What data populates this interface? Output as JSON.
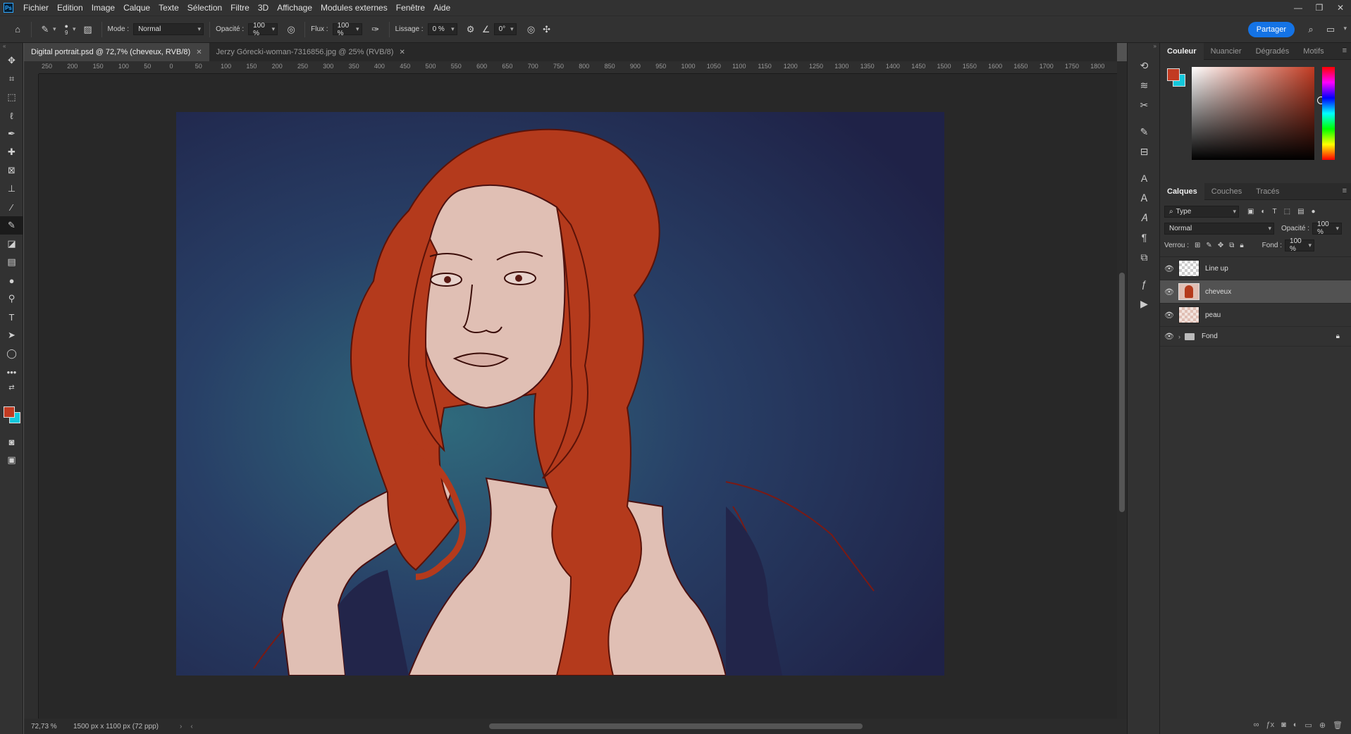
{
  "app": {
    "logo": "Ps",
    "menu": [
      "Fichier",
      "Edition",
      "Image",
      "Calque",
      "Texte",
      "Sélection",
      "Filtre",
      "3D",
      "Affichage",
      "Modules externes",
      "Fenêtre",
      "Aide"
    ]
  },
  "options": {
    "brush_size": "9",
    "mode_label": "Mode :",
    "mode_value": "Normal",
    "opacity_label": "Opacité :",
    "opacity_value": "100 %",
    "flux_label": "Flux :",
    "flux_value": "100 %",
    "lissage_label": "Lissage :",
    "lissage_value": "0 %",
    "angle_value": "0°",
    "share_label": "Partager"
  },
  "tabs": [
    {
      "label": "Digital portrait.psd @ 72,7% (cheveux, RVB/8)",
      "active": true
    },
    {
      "label": "Jerzy Górecki-woman-7316856.jpg @ 25% (RVB/8)",
      "active": false
    }
  ],
  "ruler_ticks": [
    "250",
    "200",
    "150",
    "100",
    "50",
    "0",
    "50",
    "100",
    "150",
    "200",
    "250",
    "300",
    "350",
    "400",
    "450",
    "500",
    "550",
    "600",
    "650",
    "700",
    "750",
    "800",
    "850",
    "900",
    "950",
    "1000",
    "1050",
    "1100",
    "1150",
    "1200",
    "1250",
    "1300",
    "1350",
    "1400",
    "1450",
    "1500",
    "1550",
    "1600",
    "1650",
    "1700",
    "1750",
    "1800"
  ],
  "status": {
    "zoom": "72,73 %",
    "doc_size": "1500 px x 1100 px (72 ppp)"
  },
  "color_panel": {
    "tabs": [
      "Couleur",
      "Nuancier",
      "Dégradés",
      "Motifs"
    ],
    "fg_color": "#c23b22",
    "bg_color": "#14c8dc"
  },
  "layers_panel": {
    "tabs": [
      "Calques",
      "Couches",
      "Tracés"
    ],
    "filter_label": "Type",
    "blend_mode": "Normal",
    "opacity_label": "Opacité :",
    "opacity_value": "100 %",
    "lock_label": "Verrou :",
    "fill_label": "Fond :",
    "fill_value": "100 %",
    "layers": [
      {
        "name": "Line up",
        "visible": true,
        "active": false
      },
      {
        "name": "cheveux",
        "visible": true,
        "active": true
      },
      {
        "name": "peau",
        "visible": true,
        "active": false
      },
      {
        "name": "Fond",
        "visible": true,
        "active": false,
        "group": true,
        "locked": true
      }
    ]
  }
}
